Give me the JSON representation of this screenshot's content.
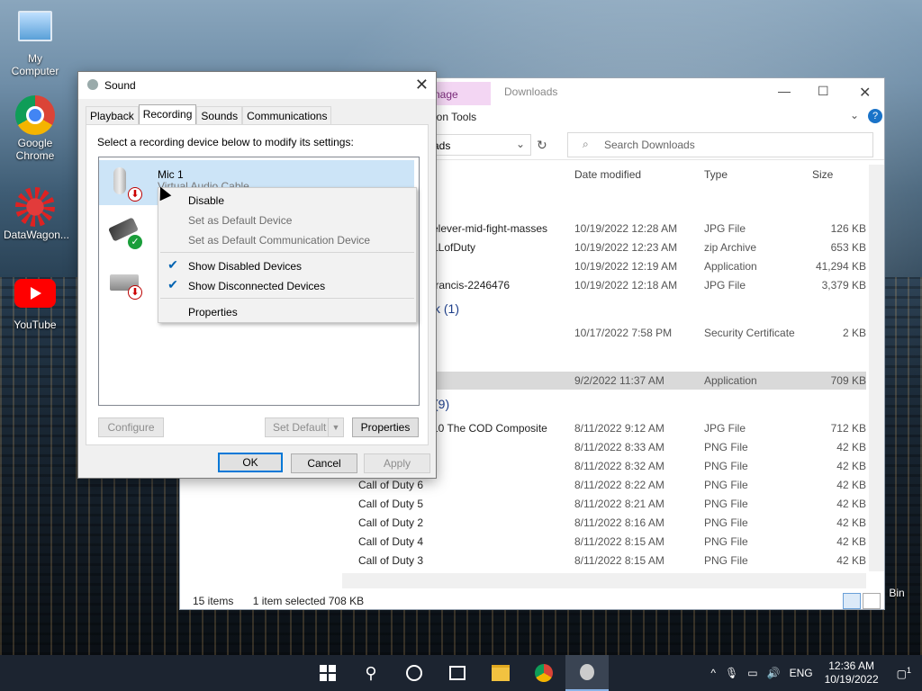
{
  "desktop": {
    "icons": [
      {
        "label": "My Computer",
        "icon": "computer-icon"
      },
      {
        "label": "Google Chrome",
        "icon": "chrome-icon"
      },
      {
        "label": "DataWagon...",
        "icon": "datawagon-icon"
      },
      {
        "label": "YouTube",
        "icon": "youtube-icon"
      },
      {
        "label": "Bin",
        "icon": "recycle-bin-icon"
      }
    ]
  },
  "explorer": {
    "ribbon_tab_fragment": "nage",
    "ribbon_subtab_fragment": "ion Tools",
    "title": "Downloads",
    "address_fragment": "ads",
    "search_placeholder": "Search Downloads",
    "columns": {
      "date": "Date modified",
      "type": "Type",
      "size": "Size"
    },
    "groups": [
      {
        "label": "k (1)"
      },
      {
        "label": "(9)"
      }
    ],
    "rows": [
      {
        "name": "elever-mid-fight-masses",
        "date": "10/19/2022 12:28 AM",
        "type": "JPG File",
        "size": "126 KB"
      },
      {
        "name": "LLofDuty",
        "date": "10/19/2022 12:23 AM",
        "type": "zip Archive",
        "size": "653 KB"
      },
      {
        "name": "",
        "date": "10/19/2022 12:19 AM",
        "type": "Application",
        "size": "41,294 KB"
      },
      {
        "name": "francis-2246476",
        "date": "10/19/2022 12:18 AM",
        "type": "JPG File",
        "size": "3,379 KB"
      },
      {
        "name": "",
        "date": "10/17/2022 7:58 PM",
        "type": "Security Certificate",
        "size": "2 KB"
      },
      {
        "name": "",
        "date": "9/2/2022 11:37 AM",
        "type": "Application",
        "size": "709 KB"
      },
      {
        "name": "10 The COD Composite",
        "date": "8/11/2022 9:12 AM",
        "type": "JPG File",
        "size": "712 KB"
      },
      {
        "name": "",
        "date": "8/11/2022 8:33 AM",
        "type": "PNG File",
        "size": "42 KB"
      },
      {
        "name": "",
        "date": "8/11/2022 8:32 AM",
        "type": "PNG File",
        "size": "42 KB"
      },
      {
        "name": "Call of Duty 6",
        "date": "8/11/2022 8:22 AM",
        "type": "PNG File",
        "size": "42 KB"
      },
      {
        "name": "Call of Duty 5",
        "date": "8/11/2022 8:21 AM",
        "type": "PNG File",
        "size": "42 KB"
      },
      {
        "name": "Call of Duty 2",
        "date": "8/11/2022 8:16 AM",
        "type": "PNG File",
        "size": "42 KB"
      },
      {
        "name": "Call of Duty 4",
        "date": "8/11/2022 8:15 AM",
        "type": "PNG File",
        "size": "42 KB"
      },
      {
        "name": "Call of Duty 3",
        "date": "8/11/2022 8:15 AM",
        "type": "PNG File",
        "size": "42 KB"
      }
    ],
    "status": {
      "items": "15 items",
      "selected": "1 item selected  708 KB"
    }
  },
  "sound": {
    "title": "Sound",
    "tabs": [
      "Playback",
      "Recording",
      "Sounds",
      "Communications"
    ],
    "active_tab": "Recording",
    "instruction": "Select a recording device below to modify its settings:",
    "devices": [
      {
        "name": "Mic 1",
        "description": "Virtual Audio Cable"
      }
    ],
    "buttons": {
      "configure": "Configure",
      "set_default": "Set Default",
      "properties": "Properties",
      "ok": "OK",
      "cancel": "Cancel",
      "apply": "Apply"
    }
  },
  "context_menu": {
    "items": [
      {
        "label": "Disable",
        "enabled": true,
        "checked": false
      },
      {
        "label": "Set as Default Device",
        "enabled": false,
        "checked": false
      },
      {
        "label": "Set as Default Communication Device",
        "enabled": false,
        "checked": false
      },
      {
        "label": "Show Disabled Devices",
        "enabled": true,
        "checked": true
      },
      {
        "label": "Show Disconnected Devices",
        "enabled": true,
        "checked": true
      },
      {
        "label": "Properties",
        "enabled": true,
        "checked": false
      }
    ]
  },
  "taskbar": {
    "language": "ENG",
    "time": "12:36 AM",
    "date": "10/19/2022",
    "notification_count": "1"
  },
  "colors": {
    "accent": "#0078d7",
    "selection": "#cce4f7",
    "taskbar": "#1c2430"
  }
}
